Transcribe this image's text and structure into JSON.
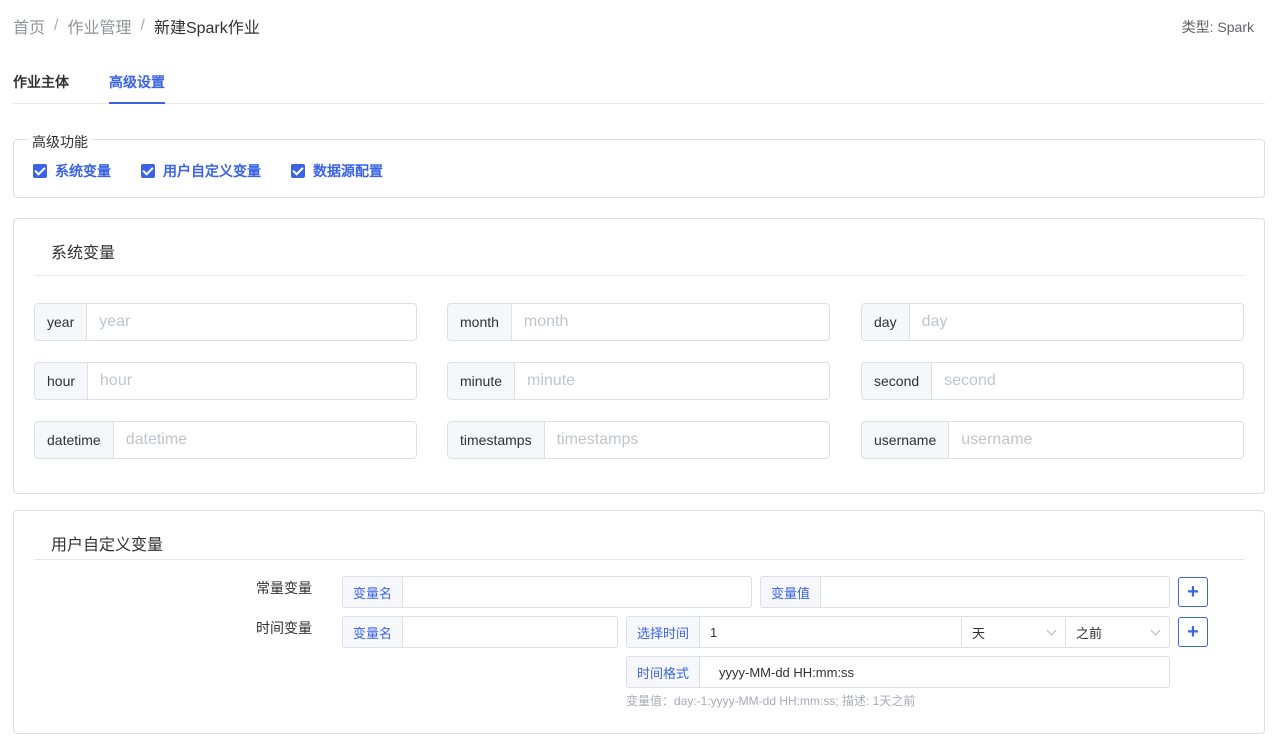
{
  "breadcrumb": {
    "home": "首页",
    "section": "作业管理",
    "current": "新建Spark作业",
    "separator": "/"
  },
  "type_label": "类型: Spark",
  "tabs": [
    {
      "label": "作业主体",
      "active": false
    },
    {
      "label": "高级设置",
      "active": true
    }
  ],
  "advanced": {
    "legend": "高级功能",
    "options": [
      {
        "label": "系统变量",
        "checked": true
      },
      {
        "label": "用户自定义变量",
        "checked": true
      },
      {
        "label": "数据源配置",
        "checked": true
      }
    ]
  },
  "system_vars": {
    "title": "系统变量",
    "fields": [
      {
        "label": "year",
        "placeholder": "year"
      },
      {
        "label": "month",
        "placeholder": "month"
      },
      {
        "label": "day",
        "placeholder": "day"
      },
      {
        "label": "hour",
        "placeholder": "hour"
      },
      {
        "label": "minute",
        "placeholder": "minute"
      },
      {
        "label": "second",
        "placeholder": "second"
      },
      {
        "label": "datetime",
        "placeholder": "datetime"
      },
      {
        "label": "timestamps",
        "placeholder": "timestamps"
      },
      {
        "label": "username",
        "placeholder": "username"
      }
    ]
  },
  "user_vars": {
    "title": "用户自定义变量",
    "constant": {
      "row_label": "常量变量",
      "name_label": "变量名",
      "name_value": "",
      "value_label": "变量值",
      "value_value": ""
    },
    "time": {
      "row_label": "时间变量",
      "name_label": "变量名",
      "name_value": "",
      "select_time_label": "选择时间",
      "amount": "1",
      "unit": "天",
      "direction": "之前",
      "format_label": "时间格式",
      "format_value": "yyyy-MM-dd HH:mm:ss",
      "hint": "变量值：day:-1;yyyy-MM-dd HH:mm:ss; 描述: 1天之前"
    },
    "add_button": "+"
  },
  "colors": {
    "accent": "#3a63e6",
    "border": "#dcdfe6",
    "label_bg": "#f5f7fa"
  }
}
